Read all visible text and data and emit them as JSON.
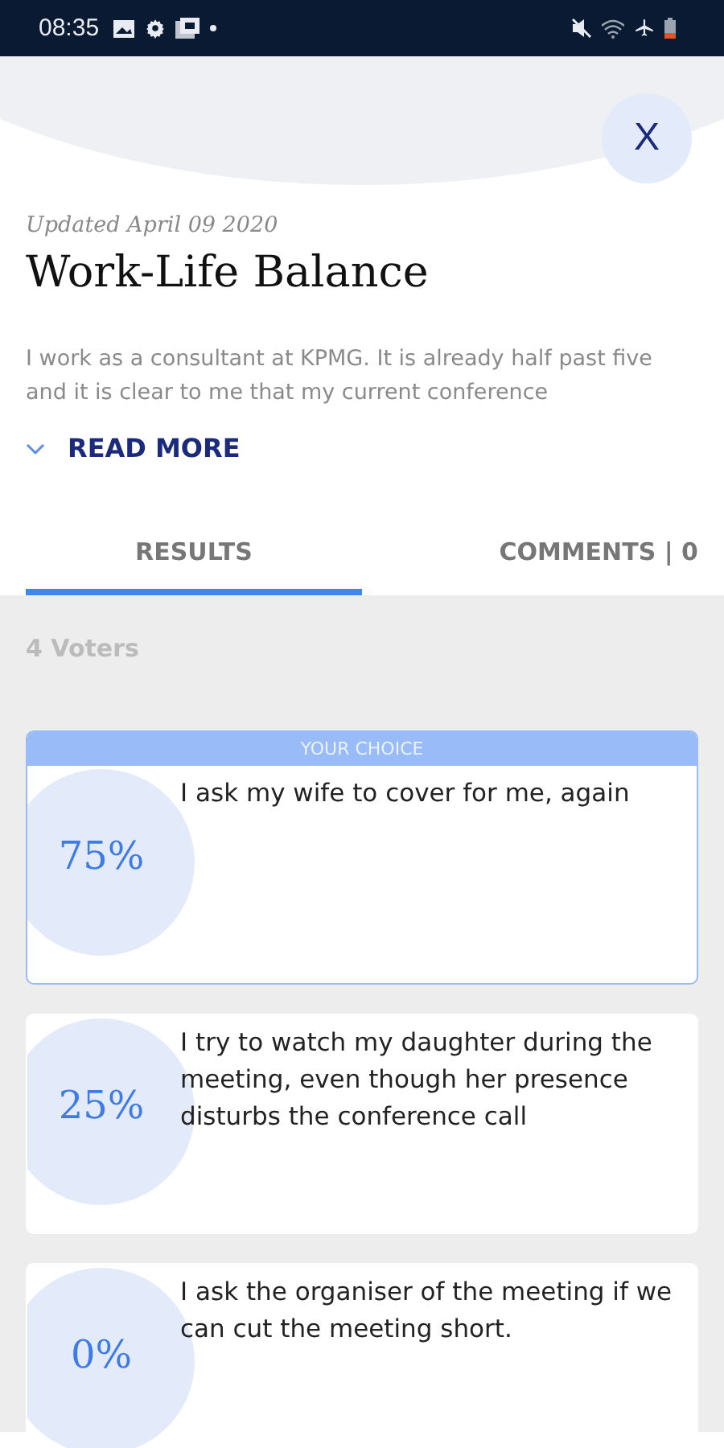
{
  "status_bar": {
    "time": "08:35"
  },
  "close_button": {
    "label": "X"
  },
  "post": {
    "updated": "Updated April 09 2020",
    "title": "Work-Life Balance",
    "excerpt": "I work as a consultant at KPMG. It is already half past five and it is clear to me that my current conference",
    "read_more": "READ MORE"
  },
  "tabs": [
    {
      "label": "RESULTS",
      "selected": true
    },
    {
      "label": "COMMENTS | 0",
      "selected": false
    }
  ],
  "voters": "4 Voters",
  "choice_label": "YOUR CHOICE",
  "options": [
    {
      "percent": "75%",
      "text": "I ask my wife to cover for me, again",
      "selected": true
    },
    {
      "percent": "25%",
      "text": "I try to watch my daughter during the meeting, even though her presence disturbs the conference call",
      "selected": false
    },
    {
      "percent": "0%",
      "text": "I ask the organiser of the meeting if we can cut the meeting short.",
      "selected": false
    }
  ]
}
